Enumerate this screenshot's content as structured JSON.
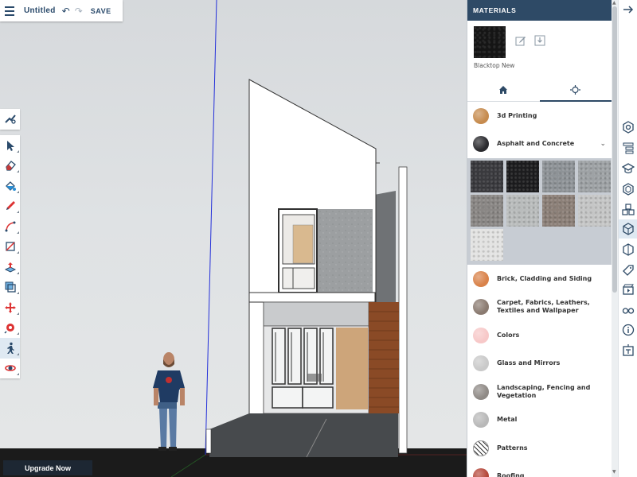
{
  "file": {
    "title": "Untitled",
    "save_label": "SAVE"
  },
  "upgrade_label": "Upgrade Now",
  "materials": {
    "header": "MATERIALS",
    "current_material": "Blacktop New",
    "tabs": [
      {
        "name": "home-icon",
        "selected": false
      },
      {
        "name": "eyedropper-icon",
        "selected": true
      }
    ],
    "categories": [
      {
        "label": "3d Printing",
        "color": "#c68b4e"
      },
      {
        "label": "Asphalt and Concrete",
        "color": "#2a2a2e",
        "expanded": true
      },
      {
        "label": "Brick, Cladding and Siding",
        "color": "#d9824a"
      },
      {
        "label": "Carpet, Fabrics, Leathers, Textiles and Wallpaper",
        "color": "#8a7a70"
      },
      {
        "label": "Colors",
        "color": "#f7c8c8"
      },
      {
        "label": "Glass and Mirrors",
        "color": "#c9c9c9"
      },
      {
        "label": "Landscaping, Fencing and Vegetation",
        "color": "#8f8a86"
      },
      {
        "label": "Metal",
        "color": "#b8b8b8"
      },
      {
        "label": "Patterns",
        "color": "#ffffff"
      },
      {
        "label": "Roofing",
        "color": "#b5473a"
      }
    ],
    "swatches": [
      "#3a3a3e",
      "#1c1c1e",
      "#8e9397",
      "#9ea2a5",
      "#8a8785",
      "#b9bcbc",
      "#8c8078",
      "#c5c6c6",
      "#e3e3e2"
    ]
  },
  "toolbar": {
    "tools": [
      {
        "name": "select-tool-icon",
        "active": false
      },
      {
        "name": "eraser-tool-icon",
        "active": false
      },
      {
        "name": "paint-bucket-tool-icon",
        "active": false
      },
      {
        "name": "pencil-tool-icon",
        "active": false
      },
      {
        "name": "arc-tool-icon",
        "active": false
      },
      {
        "name": "rectangle-tool-icon",
        "active": false
      },
      {
        "name": "push-pull-tool-icon",
        "active": false
      },
      {
        "name": "offset-tool-icon",
        "active": false
      },
      {
        "name": "move-tool-icon",
        "active": false
      },
      {
        "name": "tape-measure-tool-icon",
        "active": false
      },
      {
        "name": "walk-tool-icon",
        "active": true
      },
      {
        "name": "orbit-tool-icon",
        "active": false
      }
    ]
  },
  "rail": [
    "collapse-arrow-icon",
    "entity-info-icon",
    "outliner-icon",
    "instructor-icon",
    "components-icon",
    "3d-warehouse-icon",
    "materials-icon",
    "styles-icon",
    "tags-icon",
    "scenes-icon",
    "display-icon",
    "info-icon",
    "solar-icon"
  ]
}
